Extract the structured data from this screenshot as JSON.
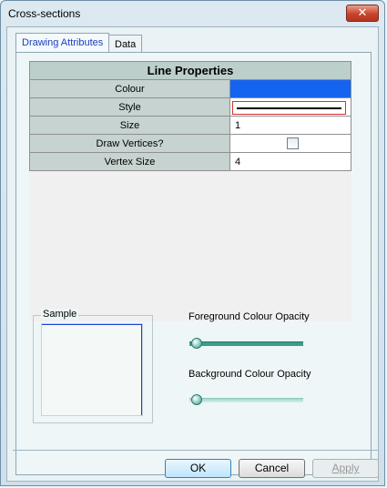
{
  "window": {
    "title": "Cross-sections",
    "close_symbol": "✕"
  },
  "tabs": [
    {
      "label": "Drawing Attributes",
      "active": true
    },
    {
      "label": "Data",
      "active": false
    }
  ],
  "properties": {
    "header": "Line Properties",
    "rows": [
      {
        "name": "Colour",
        "value": "",
        "colour": "#1464f0"
      },
      {
        "name": "Style",
        "value": ""
      },
      {
        "name": "Size",
        "value": "1"
      },
      {
        "name": "Draw Vertices?",
        "value": "",
        "checked": false
      },
      {
        "name": "Vertex Size",
        "value": "4"
      }
    ]
  },
  "sample": {
    "label": "Sample",
    "line_colour": "#1c3fd6"
  },
  "opacity": {
    "foreground_label": "Foreground Colour Opacity",
    "background_label": "Background Colour Opacity"
  },
  "buttons": {
    "ok": "OK",
    "cancel": "Cancel",
    "apply": "Apply"
  }
}
